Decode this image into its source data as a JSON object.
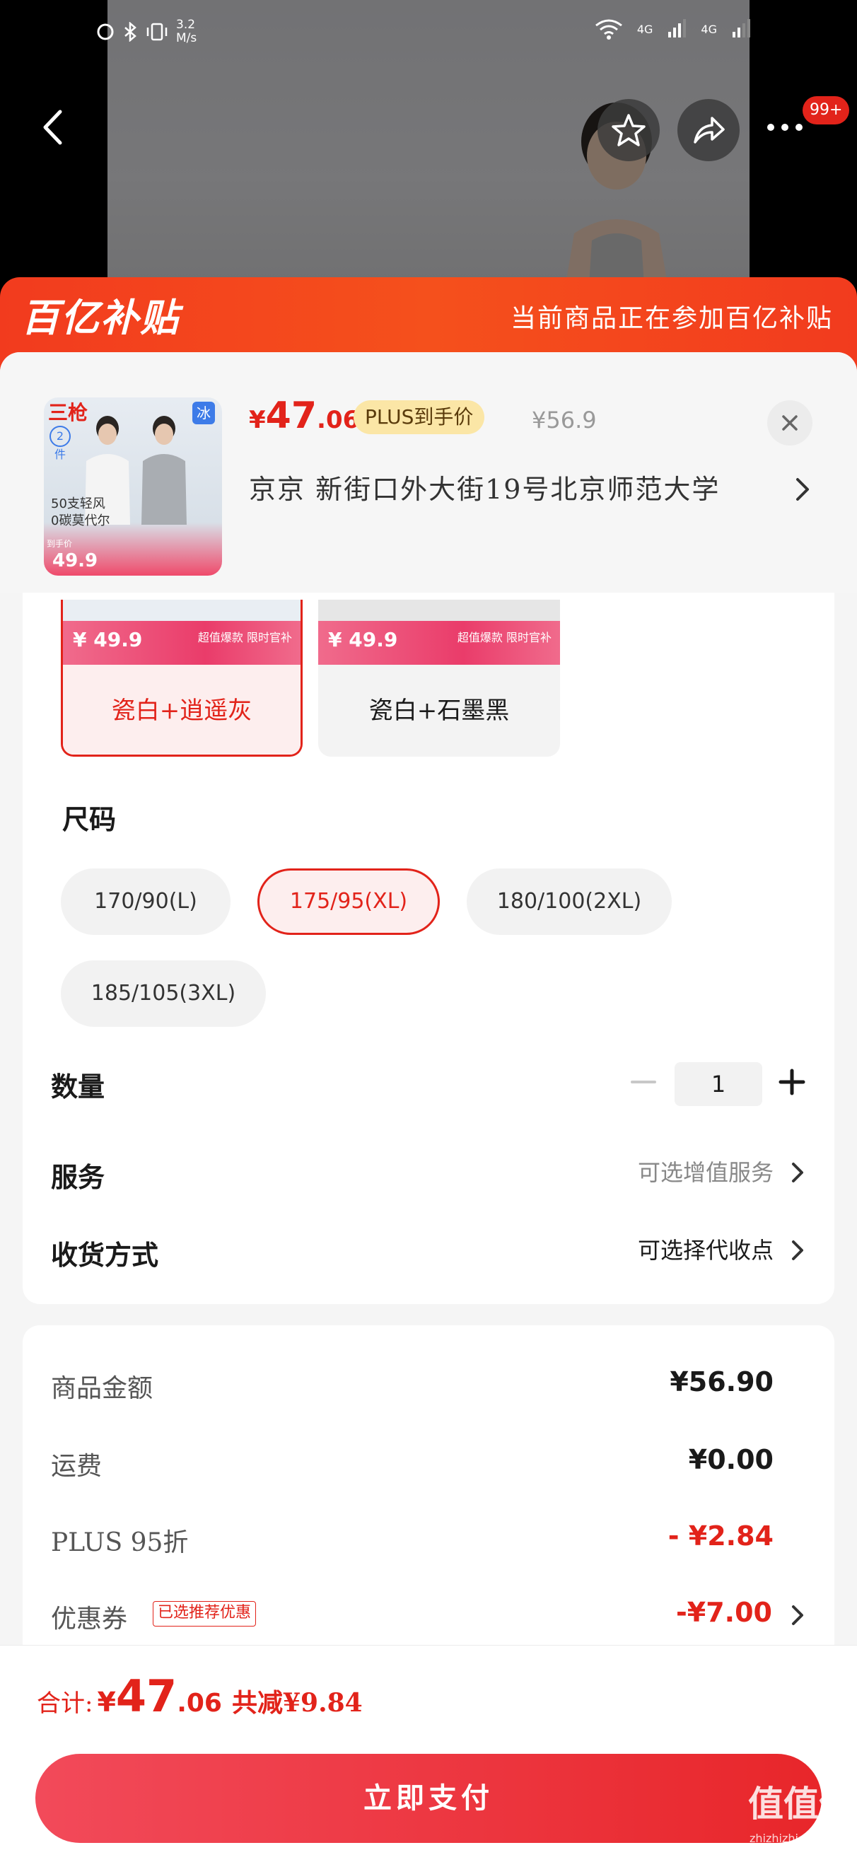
{
  "status_bar": {
    "speed": "3.2\nM/s",
    "net1": "4G",
    "net2": "4G"
  },
  "top_nav": {
    "badge": "99+"
  },
  "banner": {
    "logo": "百亿补贴",
    "text": "当前商品正在参加百亿补贴"
  },
  "product": {
    "thumbnail": {
      "brand": "三枪",
      "ice_tag": "冰",
      "count_tag": "2件",
      "line1": "50支轻风",
      "line2": "0碳莫代尔",
      "price_label": "到手价",
      "price": "49.9"
    },
    "price_yen": "¥",
    "price_int": "47",
    "price_dec": ".06",
    "plus_tag": "PLUS到手价",
    "original_price": "¥56.9",
    "address": "京京  新街口外大街19号北京师范大学"
  },
  "colors": {
    "options": [
      {
        "name": "瓷白+逍遥灰",
        "strip_price": "¥ 49.9",
        "strip_label": "超值爆款  限时官补",
        "selected": true
      },
      {
        "name": "瓷白+石墨黑",
        "strip_price": "¥ 49.9",
        "strip_label": "超值爆款  限时官补",
        "selected": false
      }
    ]
  },
  "size": {
    "title": "尺码",
    "options": [
      {
        "label": "170/90(L)",
        "selected": false
      },
      {
        "label": "175/95(XL)",
        "selected": true
      },
      {
        "label": "180/100(2XL)",
        "selected": false
      },
      {
        "label": "185/105(3XL)",
        "selected": false
      }
    ]
  },
  "quantity": {
    "label": "数量",
    "value": "1"
  },
  "service": {
    "label": "服务",
    "value": "可选增值服务"
  },
  "delivery": {
    "label": "收货方式",
    "value": "可选择代收点"
  },
  "price_detail": {
    "goods_label": "商品金额",
    "goods_value": "¥56.90",
    "shipping_label": "运费",
    "shipping_value": "¥0.00",
    "plus_label": "PLUS 95折",
    "plus_value": "- ¥2.84",
    "coupon_label": "优惠券",
    "coupon_tag": "已选推荐优惠",
    "coupon_value": "-¥7.00"
  },
  "total": {
    "label": "合计:",
    "yen": "¥",
    "int": "47",
    "dec": ".06",
    "save": "共减¥9.84"
  },
  "pay_button": "立即支付",
  "watermark": {
    "text": "值值值",
    "sub": "zhizhizhi.com"
  },
  "colors_theme": {
    "accent_red": "#e2231a",
    "banner_orange": "#f5501c",
    "plus_gold": "#fbe6a6"
  }
}
